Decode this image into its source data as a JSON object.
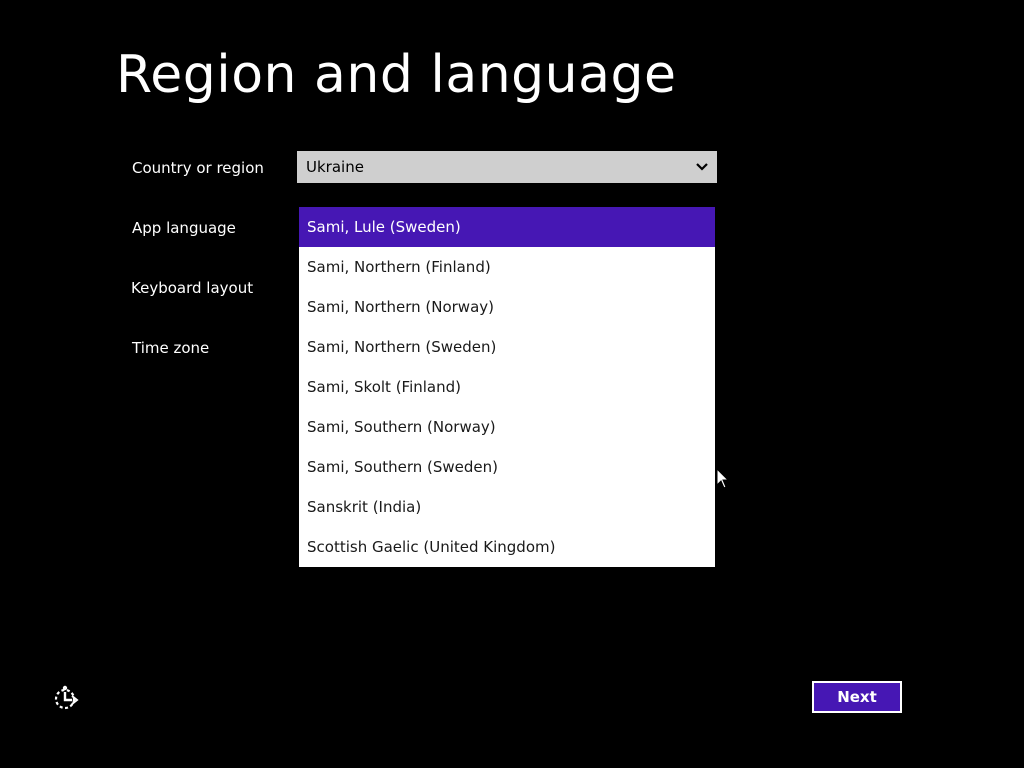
{
  "page": {
    "title": "Region and language"
  },
  "form": {
    "country_label": "Country or region",
    "country_value": "Ukraine",
    "app_language_label": "App language",
    "keyboard_layout_label": "Keyboard layout",
    "time_zone_label": "Time zone"
  },
  "dropdown": {
    "selected_index": 0,
    "options": [
      "Sami, Lule (Sweden)",
      "Sami, Northern (Finland)",
      "Sami, Northern (Norway)",
      "Sami, Northern (Sweden)",
      "Sami, Skolt (Finland)",
      "Sami, Southern (Norway)",
      "Sami, Southern (Sweden)",
      "Sanskrit (India)",
      "Scottish Gaelic (United Kingdom)"
    ]
  },
  "footer": {
    "next_label": "Next",
    "ease_of_access_icon": "ease-of-access-icon"
  },
  "colors": {
    "background": "#000000",
    "accent": "#4617b4",
    "select_background": "#cfcfcf",
    "dropdown_background": "#ffffff"
  }
}
